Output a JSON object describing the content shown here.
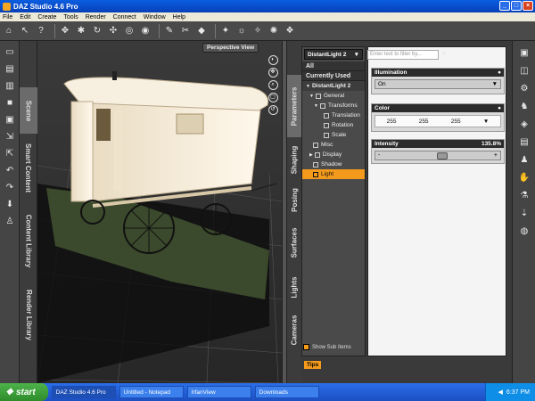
{
  "window": {
    "title": "DAZ Studio 4.6 Pro",
    "buttons": [
      "_",
      "□",
      "×"
    ]
  },
  "menu": [
    "File",
    "Edit",
    "Create",
    "Tools",
    "Render",
    "Connect",
    "Window",
    "Help"
  ],
  "toolbar_icons": [
    "home-icon",
    "select-icon",
    "help-icon",
    "node-icon",
    "joint-icon",
    "rotate-icon",
    "translate-icon",
    "scale-icon",
    "camera-icon",
    "light-icon",
    "render-icon",
    "geometry-icon",
    "spotlight-icon",
    "pointlight-icon",
    "morph-icon",
    "active-pose-icon"
  ],
  "left_tabs": [
    "Scene",
    "Smart Content",
    "Content Library",
    "Render Library"
  ],
  "viewport": {
    "view_label": "Perspective View"
  },
  "right_tabs": [
    "Parameters",
    "Shaping",
    "Posing",
    "Surfaces",
    "Lights",
    "Cameras"
  ],
  "params": {
    "node_name": "DistantLight 2",
    "tree": [
      {
        "label": "All",
        "type": "hdr"
      },
      {
        "label": "Currently Used",
        "type": "hdr"
      },
      {
        "label": "DistantLight 2",
        "type": "node"
      },
      {
        "label": "General",
        "type": "group"
      },
      {
        "label": "Transforms",
        "type": "sub"
      },
      {
        "label": "Translation",
        "type": "leaf"
      },
      {
        "label": "Rotation",
        "type": "leaf"
      },
      {
        "label": "Scale",
        "type": "leaf"
      },
      {
        "label": "Misc",
        "type": "item"
      },
      {
        "label": "Display",
        "type": "group"
      },
      {
        "label": "Shadow",
        "type": "item"
      },
      {
        "label": "Light",
        "type": "sel"
      }
    ],
    "show_sub_items": "Show Sub Items",
    "filter_placeholder": "Enter text to filter by...",
    "illumination": {
      "label": "Illumination",
      "value": "On"
    },
    "color": {
      "label": "Color",
      "r": "255",
      "g": "255",
      "b": "255"
    },
    "intensity": {
      "label": "Intensity",
      "value": "135.8%",
      "fraction": 0.54
    },
    "tips": "Tips"
  },
  "taskbar": {
    "start": "start",
    "tasks": [
      "DAZ Studio 4.6 Pro",
      "Untitled - Notepad",
      "IrfanView",
      "Downloads"
    ],
    "clock": "6:37 PM"
  },
  "colors": {
    "accent": "#f39a1c",
    "bg": "#3a3a3a"
  }
}
